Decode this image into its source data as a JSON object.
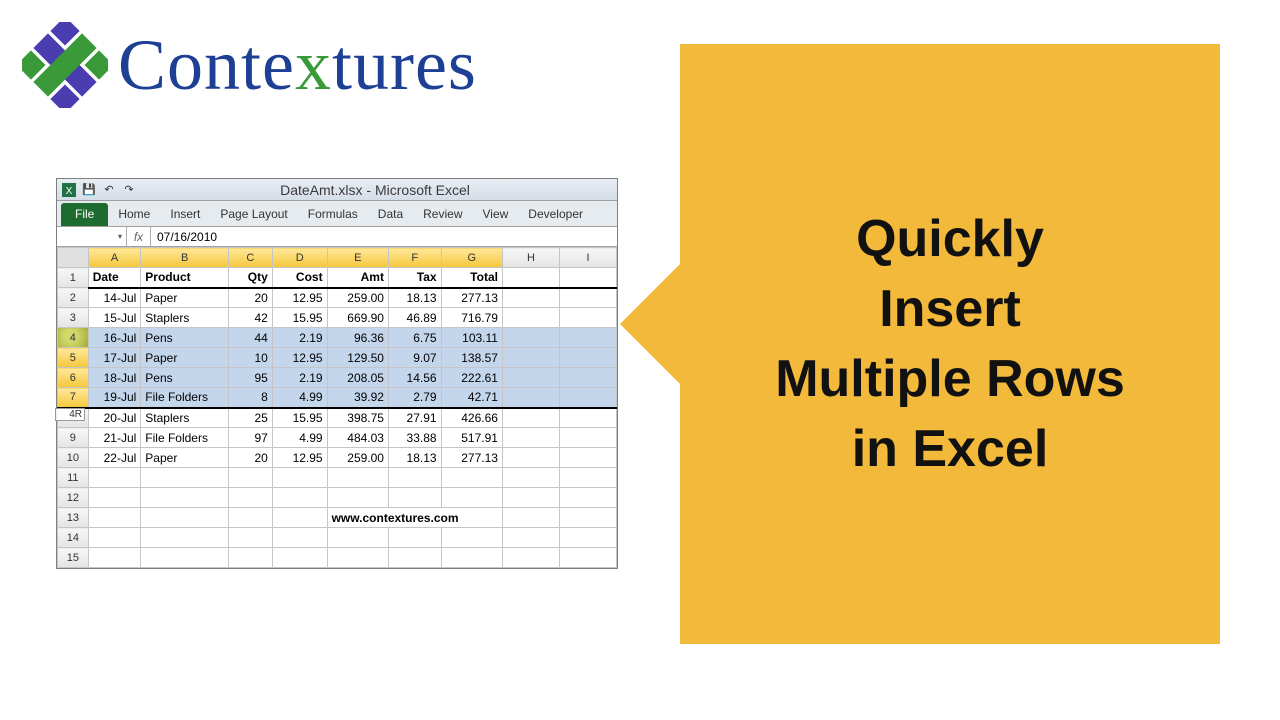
{
  "logo": {
    "text_pre": "Conte",
    "text_x": "x",
    "text_post": "tures"
  },
  "callout": {
    "line1": "Quickly",
    "line2": "Insert",
    "line3": "Multiple Rows",
    "line4": "in Excel"
  },
  "excel": {
    "title": "DateAmt.xlsx  -  Microsoft Excel",
    "qat": {
      "save": "💾",
      "undo": "↶",
      "redo": "↷"
    },
    "tabs": [
      "File",
      "Home",
      "Insert",
      "Page Layout",
      "Formulas",
      "Data",
      "Review",
      "View",
      "Developer"
    ],
    "formula": {
      "fx": "fx",
      "value": "07/16/2010"
    },
    "columns": [
      "A",
      "B",
      "C",
      "D",
      "E",
      "F",
      "G",
      "H",
      "I"
    ],
    "header_row": [
      "Date",
      "Product",
      "Qty",
      "Cost",
      "Amt",
      "Tax",
      "Total",
      "",
      ""
    ],
    "selection_counter": "4R",
    "rows": [
      {
        "n": 2,
        "sel": false,
        "cells": [
          "14-Jul",
          "Paper",
          "20",
          "12.95",
          "259.00",
          "18.13",
          "277.13",
          "",
          ""
        ]
      },
      {
        "n": 3,
        "sel": false,
        "cells": [
          "15-Jul",
          "Staplers",
          "42",
          "15.95",
          "669.90",
          "46.89",
          "716.79",
          "",
          ""
        ]
      },
      {
        "n": 4,
        "sel": true,
        "cursor": true,
        "cells": [
          "16-Jul",
          "Pens",
          "44",
          "2.19",
          "96.36",
          "6.75",
          "103.11",
          "",
          ""
        ]
      },
      {
        "n": 5,
        "sel": true,
        "cells": [
          "17-Jul",
          "Paper",
          "10",
          "12.95",
          "129.50",
          "9.07",
          "138.57",
          "",
          ""
        ]
      },
      {
        "n": 6,
        "sel": true,
        "cells": [
          "18-Jul",
          "Pens",
          "95",
          "2.19",
          "208.05",
          "14.56",
          "222.61",
          "",
          ""
        ]
      },
      {
        "n": 7,
        "sel": true,
        "cells": [
          "19-Jul",
          "File Folders",
          "8",
          "4.99",
          "39.92",
          "2.79",
          "42.71",
          "",
          ""
        ]
      },
      {
        "n": 8,
        "sel": false,
        "cells": [
          "20-Jul",
          "Staplers",
          "25",
          "15.95",
          "398.75",
          "27.91",
          "426.66",
          "",
          ""
        ]
      },
      {
        "n": 9,
        "sel": false,
        "cells": [
          "21-Jul",
          "File Folders",
          "97",
          "4.99",
          "484.03",
          "33.88",
          "517.91",
          "",
          ""
        ]
      },
      {
        "n": 10,
        "sel": false,
        "cells": [
          "22-Jul",
          "Paper",
          "20",
          "12.95",
          "259.00",
          "18.13",
          "277.13",
          "",
          ""
        ]
      },
      {
        "n": 11,
        "sel": false,
        "cells": [
          "",
          "",
          "",
          "",
          "",
          "",
          "",
          "",
          ""
        ]
      },
      {
        "n": 12,
        "sel": false,
        "cells": [
          "",
          "",
          "",
          "",
          "",
          "",
          "",
          "",
          ""
        ]
      },
      {
        "n": 13,
        "sel": false,
        "cells": [
          "",
          "",
          "",
          "",
          "",
          "",
          "www.contextures.com",
          "",
          ""
        ],
        "website_col": 4
      },
      {
        "n": 14,
        "sel": false,
        "cells": [
          "",
          "",
          "",
          "",
          "",
          "",
          "",
          "",
          ""
        ]
      },
      {
        "n": 15,
        "sel": false,
        "cells": [
          "",
          "",
          "",
          "",
          "",
          "",
          "",
          "",
          ""
        ]
      }
    ],
    "col_align": [
      "num",
      "txt",
      "num",
      "num",
      "num",
      "num",
      "num",
      "txt",
      "txt"
    ]
  }
}
